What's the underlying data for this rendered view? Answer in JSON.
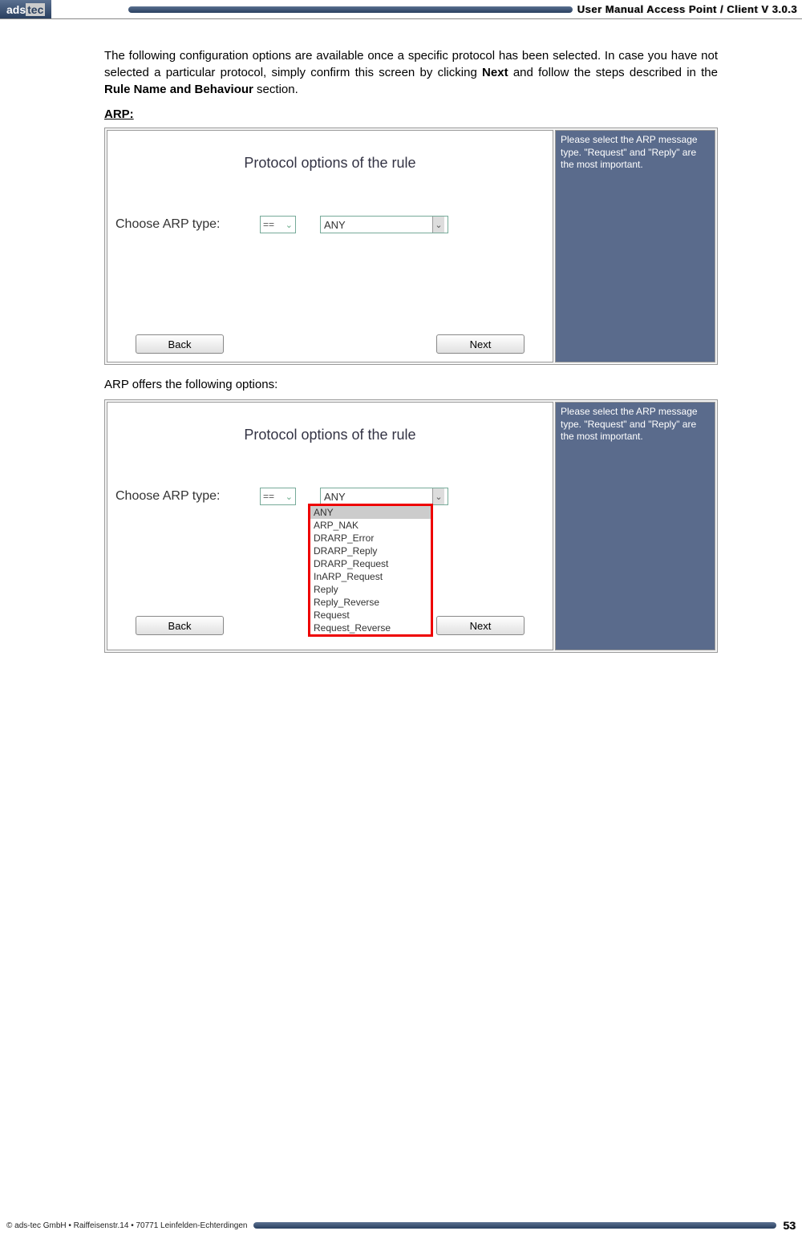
{
  "header": {
    "logo_left": "ads",
    "logo_right": "tec",
    "title": "User Manual Access  Point / Client V 3.0.3"
  },
  "intro": "The following configuration options are available once a specific protocol has been selected. In case you have not selected a particular protocol, simply confirm this screen by clicking ",
  "intro_bold1": "Next",
  "intro_mid": " and follow the steps described in the ",
  "intro_bold2": "Rule Name and Behaviour",
  "intro_end": " section.",
  "arp_label": "ARP:",
  "panel": {
    "title": "Protocol options of the rule",
    "field_label": "Choose ARP type:",
    "op_value": "==",
    "select_value": "ANY",
    "back": "Back",
    "next": "Next",
    "help": "Please select the ARP message type. \"Request\" and \"Reply\" are the most important."
  },
  "caption": "ARP offers the following options:",
  "options": [
    "ANY",
    "ARP_NAK",
    "DRARP_Error",
    "DRARP_Reply",
    "DRARP_Request",
    "InARP_Request",
    "Reply",
    "Reply_Reverse",
    "Request",
    "Request_Reverse"
  ],
  "footer": {
    "copyright": "© ads-tec GmbH • Raiffeisenstr.14 • 70771 Leinfelden-Echterdingen",
    "page": "53"
  }
}
